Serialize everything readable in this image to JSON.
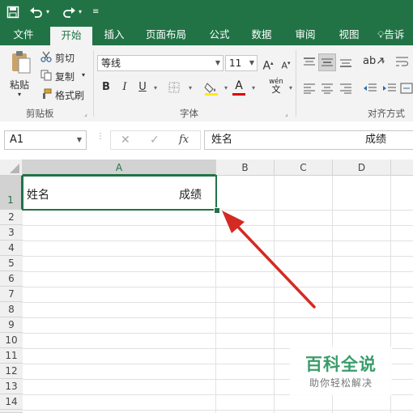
{
  "titlebar": {
    "icons": [
      "save-icon",
      "undo-icon",
      "redo-icon",
      "customize-icon"
    ]
  },
  "tabs": [
    {
      "label": "文件"
    },
    {
      "label": "开始",
      "active": true
    },
    {
      "label": "插入"
    },
    {
      "label": "页面布局"
    },
    {
      "label": "公式"
    },
    {
      "label": "数据"
    },
    {
      "label": "审阅"
    },
    {
      "label": "视图"
    },
    {
      "label": "告诉"
    }
  ],
  "ribbon": {
    "clipboard": {
      "paste": "粘贴",
      "cut": "剪切",
      "copy": "复制",
      "format_painter": "格式刷",
      "group": "剪贴板"
    },
    "font": {
      "name": "等线",
      "size": "11",
      "bold": "B",
      "italic": "I",
      "underline": "U",
      "phonetic": "wén",
      "group": "字体"
    },
    "alignment": {
      "group": "对齐方式"
    }
  },
  "formula_bar": {
    "name_box": "A1",
    "fx": "fx",
    "content_left": "姓名",
    "content_right": "成绩"
  },
  "grid": {
    "columns": [
      "A",
      "B",
      "C",
      "D"
    ],
    "rows": [
      "1",
      "2",
      "3",
      "4",
      "5",
      "6",
      "7",
      "8",
      "9",
      "10",
      "11",
      "12",
      "13",
      "14"
    ],
    "a1_left": "姓名",
    "a1_right": "成绩"
  },
  "watermark": {
    "title": "百科全说",
    "subtitle": "助你轻松解决"
  },
  "colors": {
    "accent": "#217346",
    "arrow": "#d42a24"
  }
}
